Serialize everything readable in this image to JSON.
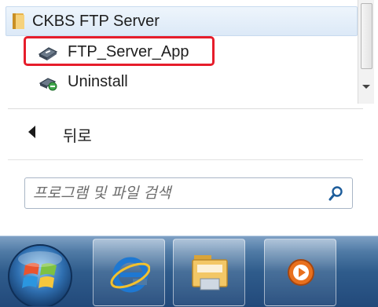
{
  "start_menu": {
    "folder": {
      "label": "CKBS FTP Server",
      "icon": "folder-icon"
    },
    "items": [
      {
        "label": "FTP_Server_App",
        "icon": "app-icon",
        "highlighted": true
      },
      {
        "label": "Uninstall",
        "icon": "uninstall-icon"
      }
    ],
    "back_label": "뒤로",
    "search": {
      "placeholder": "프로그램 및 파일 검색",
      "icon": "search-icon"
    }
  },
  "taskbar": {
    "start_button": "windows-orb-icon",
    "pinned": [
      "internet-explorer-icon",
      "file-explorer-icon",
      "media-player-icon"
    ]
  },
  "colors": {
    "highlight_outline": "#e61d2b",
    "selected_row": "#dce9f7",
    "taskbar": "#2f5c8c"
  }
}
